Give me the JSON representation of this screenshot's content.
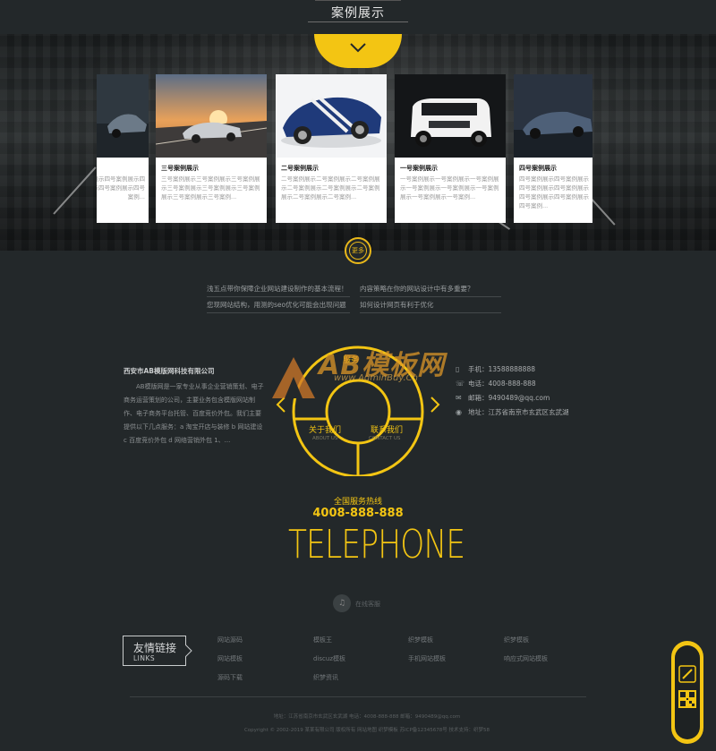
{
  "header": {
    "title": "案例展示"
  },
  "colors": {
    "accent": "#f3c513",
    "background": "#23282a"
  },
  "showcase": {
    "cards": [
      {
        "title": "",
        "text": "四号案例展示四号案例展示四号案例展示四号案例展示四号案例..."
      },
      {
        "title": "三号案例展示",
        "text": "三号案例展示三号案例展示三号案例展示三号案例展示三号案例展示三号案例展示三号案例展示三号案例..."
      },
      {
        "title": "二号案例展示",
        "text": "二号案例展示二号案例展示二号案例展示二号案例展示二号案例展示二号案例展示二号案例展示二号案例..."
      },
      {
        "title": "一号案例展示",
        "text": "一号案例展示一号案例展示一号案例展示一号案例展示一号案例展示一号案例展示一号案例展示一号案例..."
      },
      {
        "title": "四号案例展示",
        "text": "四号案例展示四号案例展示四号案例展示四号案例展示四号案例展示四号案例展示四号案例..."
      }
    ],
    "more_label": "更多"
  },
  "news": [
    "浅五点带你保障企业网站建设制作的基本流程！",
    "内容策略在你的网站设计中有多重要？",
    "您现网站结构，用测的seo优化可能会出现问题",
    "如何设计网页有利于优化"
  ],
  "company": {
    "name": "西安市AB模版网科技有限公司",
    "text": "AB模版网是一家专业从事企业营销策划、电子商务运营策划的公司，主要业务包含模版网站制作、电子商务平台托管、百度竞价外包。我们主要提供以下几点服务：a 淘宝开店与装修 b 网站建设 c 百度竞价外包 d 网络营销外包 1、..."
  },
  "contact": [
    {
      "icon": "phone-icon",
      "label": "手机：",
      "value": "13588888888"
    },
    {
      "icon": "telephone-icon",
      "label": "电话：",
      "value": "4008-888-888"
    },
    {
      "icon": "mail-icon",
      "label": "邮箱：",
      "value": "9490489@qq.com"
    },
    {
      "icon": "location-icon",
      "label": "地址：",
      "value": "江苏省南京市玄武区玄武湖"
    }
  ],
  "wheel": {
    "top_label": "服务",
    "left_label": "关于我们",
    "left_sub": "ABOUT US",
    "right_label": "联系我们",
    "right_sub": "CONTACT US"
  },
  "watermark": {
    "text": "AB模板网",
    "sub": "www.AdminBuy.Cn"
  },
  "hotline": {
    "title": "全国服务热线",
    "number": "4008-888-888",
    "word": "TELEPHONE"
  },
  "online": {
    "label": "在线客服"
  },
  "links": {
    "title_cn": "友情链接",
    "title_en": "LINKS",
    "items": [
      "网站源码",
      "模板王",
      "织梦模板",
      "织梦模板",
      "网站模板",
      "discuz模板",
      "手机网站模板",
      "响应式网站模板",
      "源码下载",
      "织梦资讯"
    ]
  },
  "footer": {
    "line1": "地址：江苏省南京市玄武区玄武湖   电话：4008-888-888   邮箱：9490489@qq.com",
    "line2": "Copyright © 2002-2019 某某有限公司 版权所有   网站地图   织梦模板   苏ICP备12345678号   技术支持：织梦58"
  }
}
